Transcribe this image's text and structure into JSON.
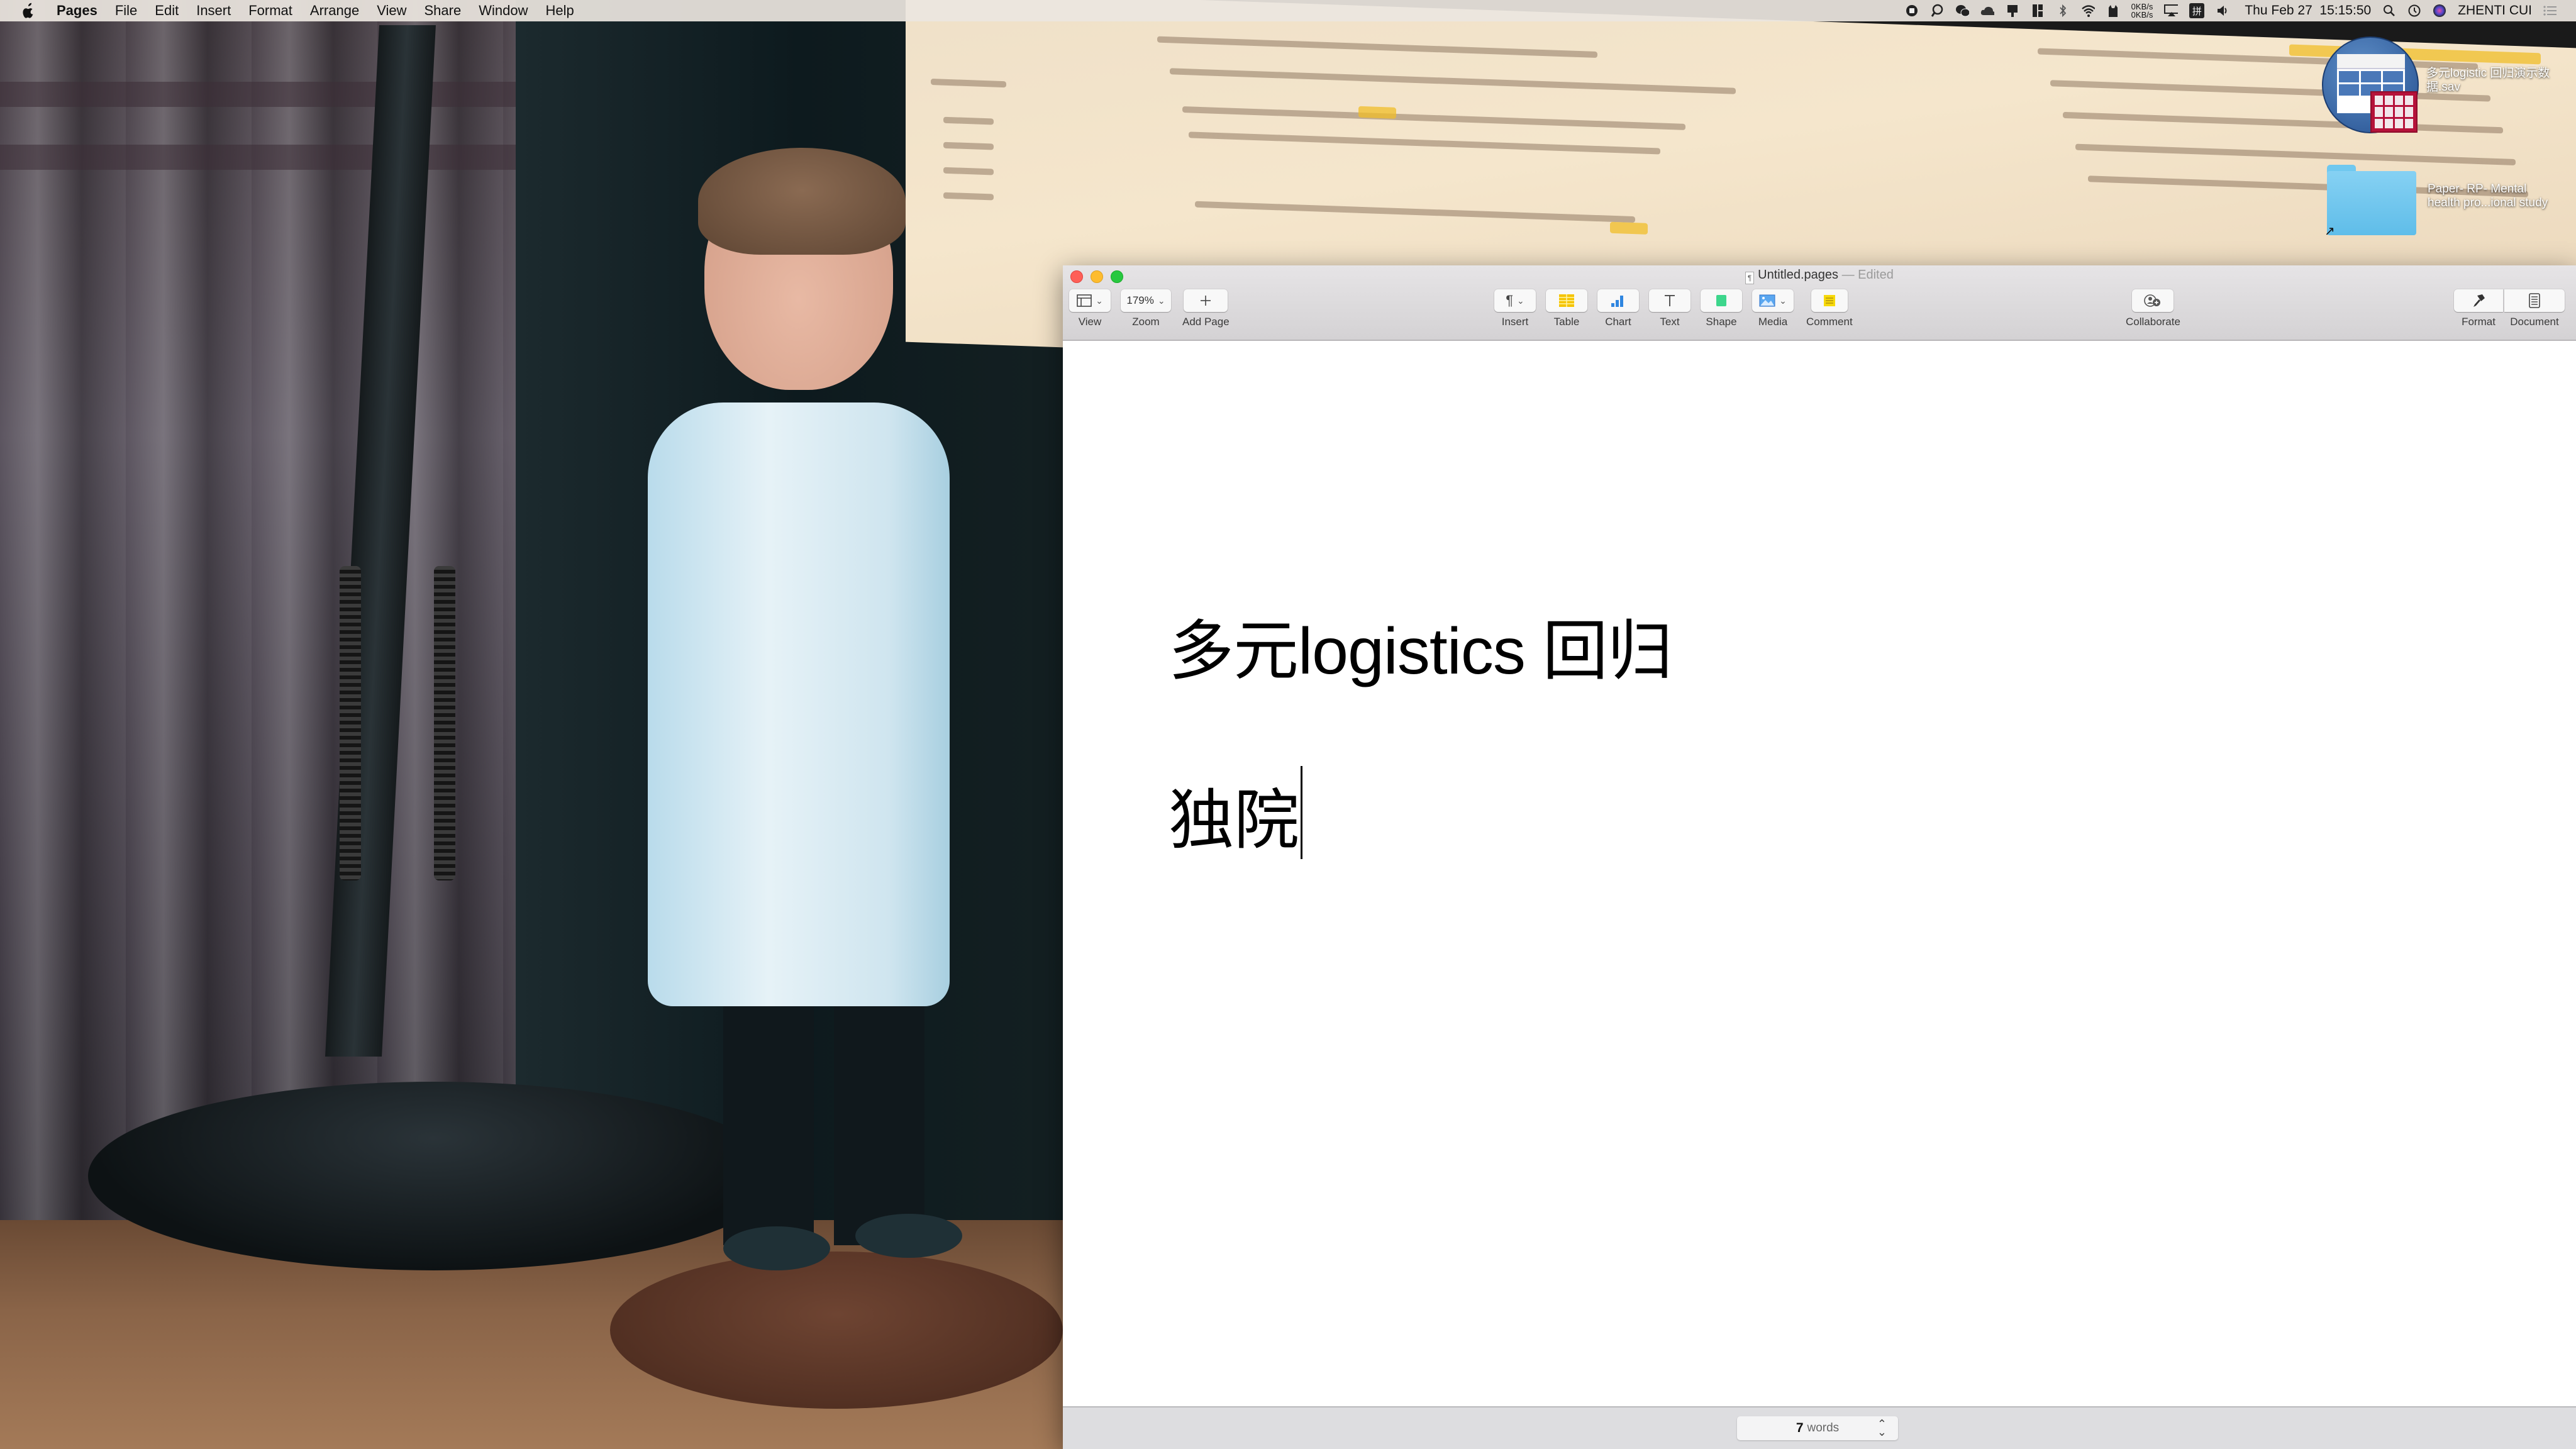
{
  "menubar": {
    "app_name": "Pages",
    "items": [
      "File",
      "Edit",
      "Insert",
      "Format",
      "Arrange",
      "View",
      "Share",
      "Window",
      "Help"
    ],
    "status": {
      "net_up": "0KB/s",
      "net_down": "0KB/s",
      "input_method": "拼",
      "datetime": "Thu Feb 27  15:15:50",
      "user": "ZHENTI CUI"
    }
  },
  "desktop": {
    "icons": [
      {
        "label": "多元logistic 回归演示数据.sav",
        "type": "spss-data-file"
      },
      {
        "label": "Paper- RP- Mental health pro...ional study",
        "type": "folder-alias"
      }
    ]
  },
  "window": {
    "title": "Untitled.pages",
    "title_suffix": "— Edited",
    "toolbar": {
      "view": {
        "label": "View"
      },
      "zoom": {
        "label": "Zoom",
        "value": "179%"
      },
      "add_page": {
        "label": "Add Page"
      },
      "insert": {
        "label": "Insert"
      },
      "table": {
        "label": "Table"
      },
      "chart": {
        "label": "Chart"
      },
      "text": {
        "label": "Text"
      },
      "shape": {
        "label": "Shape"
      },
      "media": {
        "label": "Media"
      },
      "comment": {
        "label": "Comment"
      },
      "collaborate": {
        "label": "Collaborate"
      },
      "format": {
        "label": "Format"
      },
      "document": {
        "label": "Document"
      }
    },
    "document": {
      "lines": [
        "多元logistics 回归",
        "独院"
      ]
    },
    "statusbar": {
      "word_count": "7",
      "word_label": "words"
    }
  },
  "colors": {
    "close": "#fe5f57",
    "minimize": "#febc2e",
    "maximize": "#28c840",
    "table_icon": "#f5c400",
    "chart_icon": "#2f86e0",
    "shape_icon": "#3dd68c",
    "comment_icon": "#f7d90a"
  }
}
